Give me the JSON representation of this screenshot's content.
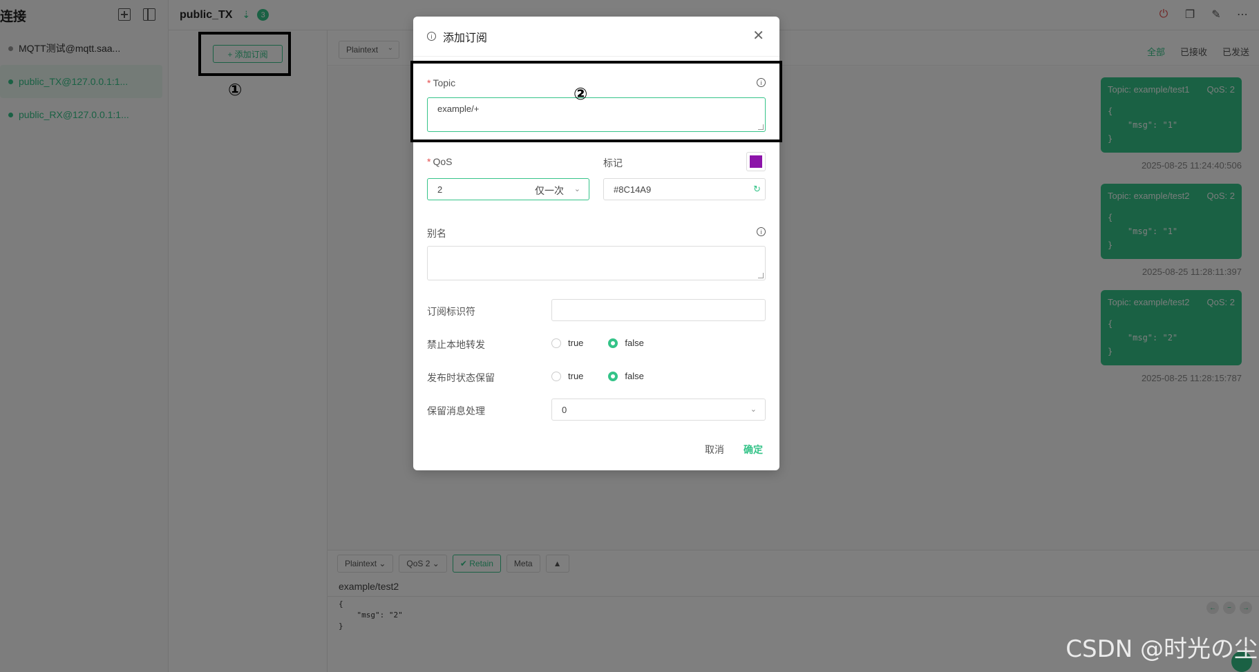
{
  "sidebar": {
    "title": "连接",
    "connections": [
      {
        "label": "MQTT测试@mqtt.saa...",
        "color": "#999999",
        "active": false
      },
      {
        "label": "public_TX@127.0.0.1:1...",
        "color": "#34c388",
        "active": true
      },
      {
        "label": "public_RX@127.0.0.1:1...",
        "color": "#34c388",
        "active": false
      }
    ]
  },
  "topbar": {
    "title": "public_TX",
    "badge": "3"
  },
  "subscriptions": {
    "add_button": "+ 添加订阅"
  },
  "messages": {
    "format": "Plaintext",
    "tabs": [
      "全部",
      "已接收",
      "已发送"
    ],
    "items": [
      {
        "topic": "Topic: example/test1",
        "qos": "QoS: 2",
        "payload": "{\n    \"msg\": \"1\"\n}",
        "time": "2025-08-25 11:24:40:506"
      },
      {
        "topic": "Topic: example/test2",
        "qos": "QoS: 2",
        "payload": "{\n    \"msg\": \"1\"\n}",
        "time": "2025-08-25 11:28:11:397"
      },
      {
        "topic": "Topic: example/test2",
        "qos": "QoS: 2",
        "payload": "{\n    \"msg\": \"2\"\n}",
        "time": "2025-08-25 11:28:15:787"
      }
    ]
  },
  "editor": {
    "format": "Plaintext",
    "qos": "QoS 2",
    "retain": "Retain",
    "meta": "Meta",
    "topic": "example/test2",
    "payload": "{\n    \"msg\": \"2\"\n}"
  },
  "modal": {
    "title": "添加订阅",
    "topic_label": "Topic",
    "topic_value": "example/+",
    "qos_label": "QoS",
    "qos_value": "2",
    "qos_desc": "仅一次",
    "mark_label": "标记",
    "mark_color": "#8C14A9",
    "alias_label": "别名",
    "alias_value": "",
    "sub_id_label": "订阅标识符",
    "sub_id_value": "",
    "no_local_label": "禁止本地转发",
    "rap_label": "发布时状态保留",
    "retain_handling_label": "保留消息处理",
    "retain_handling_value": "0",
    "opt_true": "true",
    "opt_false": "false",
    "cancel": "取消",
    "confirm": "确定"
  },
  "annotations": {
    "step1": "①",
    "step2": "②"
  },
  "watermark": "CSDN @时光の尘"
}
